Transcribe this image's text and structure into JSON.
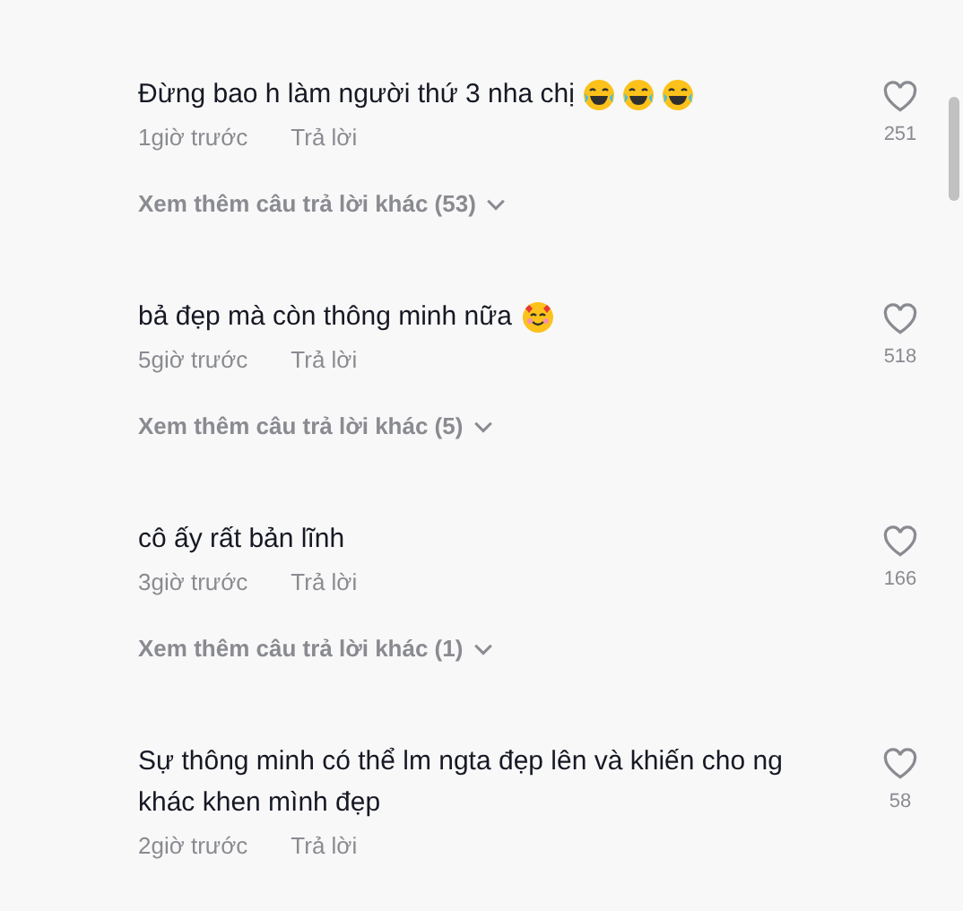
{
  "comments": [
    {
      "text": "Đừng bao h làm người thứ 3 nha chị",
      "emoji": [
        {
          "kind": "tears-of-joy"
        },
        {
          "kind": "tears-of-joy"
        },
        {
          "kind": "tears-of-joy"
        }
      ],
      "time": "1giờ trước",
      "reply": "Trả lời",
      "likes": "251",
      "liked": false,
      "more_replies": "Xem thêm câu trả lời khác (53)"
    },
    {
      "text": "bả đẹp mà còn thông minh nữa",
      "emoji": [
        {
          "kind": "hearts-face"
        }
      ],
      "time": "5giờ trước",
      "reply": "Trả lời",
      "likes": "518",
      "liked": false,
      "more_replies": "Xem thêm câu trả lời khác (5)"
    },
    {
      "text": "cô ấy rất bản lĩnh",
      "time": "3giờ trước",
      "reply": "Trả lời",
      "likes": "166",
      "liked": false,
      "more_replies": "Xem thêm câu trả lời khác (1)"
    },
    {
      "text": "Sự thông minh có thể lm ngta đẹp lên và khiến cho ng khác khen mình đẹp",
      "time": "2giờ trước",
      "reply": "Trả lời",
      "likes": "58",
      "liked": false
    }
  ]
}
